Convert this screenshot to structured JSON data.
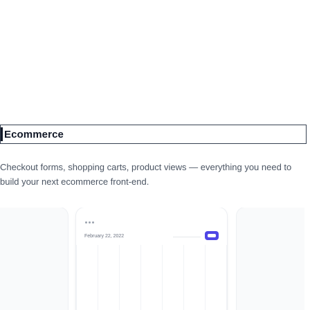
{
  "category": {
    "title": "Ecommerce",
    "description": "Checkout forms, shopping carts, product views — everything you need to build your next ecommerce front-end."
  },
  "preview": {
    "date": "February 22, 2022",
    "icons": {
      "menu": "more-dots-icon",
      "action": "toggle-icon"
    },
    "colors": {
      "accent": "#4f46e5",
      "card_bg": "#f9fafb"
    }
  }
}
